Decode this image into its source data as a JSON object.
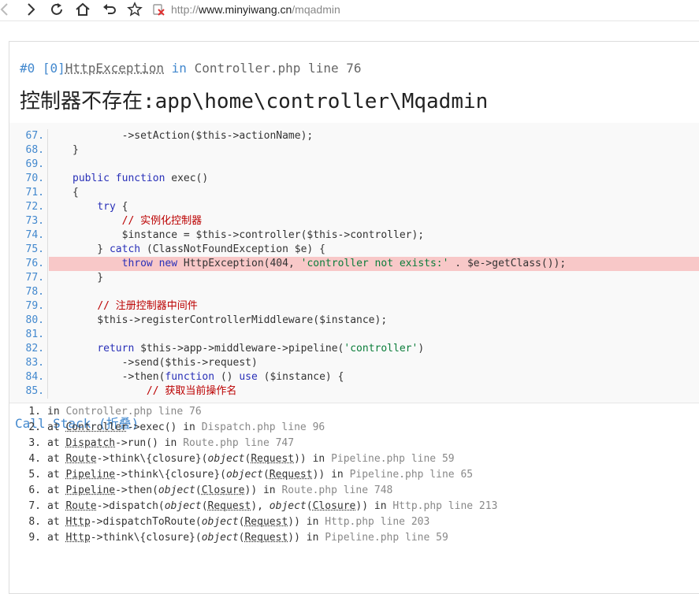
{
  "browser": {
    "url_scheme": "http://",
    "url_host": "www.minyiwang.cn",
    "url_path": "/mqadmin",
    "icons": [
      "back-icon",
      "forward-icon",
      "reload-icon",
      "home-icon",
      "undo-icon",
      "star-icon",
      "security-warning-icon"
    ]
  },
  "exception": {
    "prefix": "#0 [0]",
    "type": "HttpException",
    "in_word": " in ",
    "file": "Controller.php",
    "line_label": " line 76",
    "message": "控制器不存在:app\\home\\controller\\Mqadmin"
  },
  "source": {
    "highlight_line": "76.",
    "lines": [
      {
        "no": "67.",
        "text": "        ->setAction($this->actionName);"
      },
      {
        "no": "68.",
        "text": "}"
      },
      {
        "no": "69.",
        "text": ""
      },
      {
        "no": "70.",
        "text": "public function exec()"
      },
      {
        "no": "71.",
        "text": "{"
      },
      {
        "no": "72.",
        "text": "    try {"
      },
      {
        "no": "73.",
        "text": "        // 实例化控制器"
      },
      {
        "no": "74.",
        "text": "        $instance = $this->controller($this->controller);"
      },
      {
        "no": "75.",
        "text": "    } catch (ClassNotFoundException $e) {"
      },
      {
        "no": "76.",
        "text": "        throw new HttpException(404, 'controller not exists:' . $e->getClass());"
      },
      {
        "no": "77.",
        "text": "    }"
      },
      {
        "no": "78.",
        "text": ""
      },
      {
        "no": "79.",
        "text": "    // 注册控制器中间件"
      },
      {
        "no": "80.",
        "text": "    $this->registerControllerMiddleware($instance);"
      },
      {
        "no": "81.",
        "text": ""
      },
      {
        "no": "82.",
        "text": "    return $this->app->middleware->pipeline('controller')"
      },
      {
        "no": "83.",
        "text": "        ->send($this->request)"
      },
      {
        "no": "84.",
        "text": "        ->then(function () use ($instance) {"
      },
      {
        "no": "85.",
        "text": "            // 获取当前操作名"
      }
    ]
  },
  "call_stack": {
    "title": "Call Stack (折叠)",
    "items": [
      {
        "num": "1.",
        "parts": [
          [
            "t",
            "in "
          ],
          [
            "g",
            "Controller.php line 76"
          ]
        ]
      },
      {
        "num": "2.",
        "parts": [
          [
            "t",
            "at "
          ],
          [
            "a",
            "Controller"
          ],
          [
            "t",
            "->exec() in "
          ],
          [
            "g",
            "Dispatch.php line 96"
          ]
        ]
      },
      {
        "num": "3.",
        "parts": [
          [
            "t",
            "at "
          ],
          [
            "a",
            "Dispatch"
          ],
          [
            "t",
            "->run() in "
          ],
          [
            "g",
            "Route.php line 747"
          ]
        ]
      },
      {
        "num": "4.",
        "parts": [
          [
            "t",
            "at "
          ],
          [
            "a",
            "Route"
          ],
          [
            "t",
            "->think\\{closure}("
          ],
          [
            "i",
            "object"
          ],
          [
            "t",
            "("
          ],
          [
            "a",
            "Request"
          ],
          [
            "t",
            ")) in "
          ],
          [
            "g",
            "Pipeline.php line 59"
          ]
        ]
      },
      {
        "num": "5.",
        "parts": [
          [
            "t",
            "at "
          ],
          [
            "a",
            "Pipeline"
          ],
          [
            "t",
            "->think\\{closure}("
          ],
          [
            "i",
            "object"
          ],
          [
            "t",
            "("
          ],
          [
            "a",
            "Request"
          ],
          [
            "t",
            ")) in "
          ],
          [
            "g",
            "Pipeline.php line 65"
          ]
        ]
      },
      {
        "num": "6.",
        "parts": [
          [
            "t",
            "at "
          ],
          [
            "a",
            "Pipeline"
          ],
          [
            "t",
            "->then("
          ],
          [
            "i",
            "object"
          ],
          [
            "t",
            "("
          ],
          [
            "a",
            "Closure"
          ],
          [
            "t",
            ")) in "
          ],
          [
            "g",
            "Route.php line 748"
          ]
        ]
      },
      {
        "num": "7.",
        "parts": [
          [
            "t",
            "at "
          ],
          [
            "a",
            "Route"
          ],
          [
            "t",
            "->dispatch("
          ],
          [
            "i",
            "object"
          ],
          [
            "t",
            "("
          ],
          [
            "a",
            "Request"
          ],
          [
            "t",
            "), "
          ],
          [
            "i",
            "object"
          ],
          [
            "t",
            "("
          ],
          [
            "a",
            "Closure"
          ],
          [
            "t",
            ")) in "
          ],
          [
            "g",
            "Http.php line 213"
          ]
        ]
      },
      {
        "num": "8.",
        "parts": [
          [
            "t",
            "at "
          ],
          [
            "a",
            "Http"
          ],
          [
            "t",
            "->dispatchToRoute("
          ],
          [
            "i",
            "object"
          ],
          [
            "t",
            "("
          ],
          [
            "a",
            "Request"
          ],
          [
            "t",
            ")) in "
          ],
          [
            "g",
            "Http.php line 203"
          ]
        ]
      },
      {
        "num": "9.",
        "parts": [
          [
            "t",
            "at "
          ],
          [
            "a",
            "Http"
          ],
          [
            "t",
            "->think\\{closure}("
          ],
          [
            "i",
            "object"
          ],
          [
            "t",
            "("
          ],
          [
            "a",
            "Request"
          ],
          [
            "t",
            ")) in "
          ],
          [
            "g",
            "Pipeline.php line 59"
          ]
        ]
      }
    ]
  }
}
